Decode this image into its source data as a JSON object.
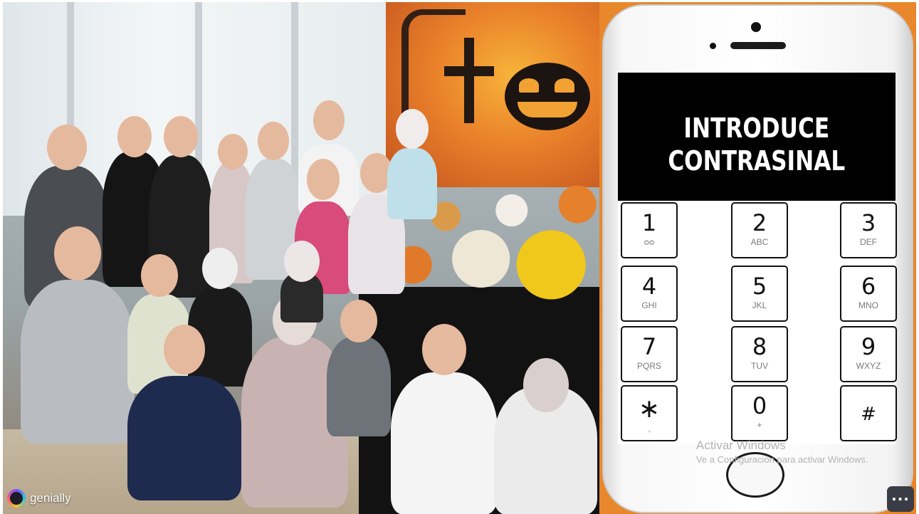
{
  "photo": {
    "alt_subject": "halloween-class-photo"
  },
  "phone": {
    "header_title": "INTRODUCE\nCONTRASINAL",
    "keys": [
      {
        "digit": "1",
        "letters": "ᴑᴑ",
        "name": "key-1"
      },
      {
        "digit": "2",
        "letters": "ABC",
        "name": "key-2"
      },
      {
        "digit": "3",
        "letters": "DEF",
        "name": "key-3"
      },
      {
        "digit": "4",
        "letters": "GHI",
        "name": "key-4"
      },
      {
        "digit": "5",
        "letters": "JKL",
        "name": "key-5"
      },
      {
        "digit": "6",
        "letters": "MNO",
        "name": "key-6"
      },
      {
        "digit": "7",
        "letters": "PQRS",
        "name": "key-7"
      },
      {
        "digit": "8",
        "letters": "TUV",
        "name": "key-8"
      },
      {
        "digit": "9",
        "letters": "WXYZ",
        "name": "key-9"
      },
      {
        "digit": "∗",
        "letters": ",",
        "name": "key-star"
      },
      {
        "digit": "0",
        "letters": "+",
        "name": "key-0"
      },
      {
        "digit": "#",
        "letters": "",
        "name": "key-hash"
      }
    ]
  },
  "watermark": {
    "line1": "Activar Windows",
    "line2": "Ve a Configuración para activar Windows."
  },
  "brand": {
    "name": "genially"
  },
  "more_button": {
    "label": "···"
  },
  "colors": {
    "panel_orange": "#e9872c",
    "screen_header": "#000000",
    "more_button_bg": "#3a3d45"
  }
}
